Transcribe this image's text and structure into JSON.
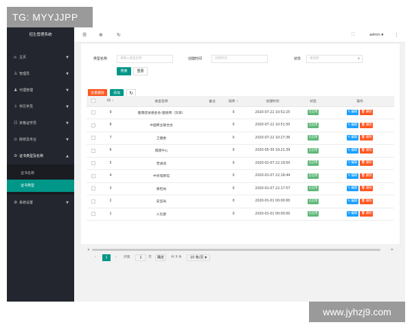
{
  "watermark_top": "TG: MYYJJPP",
  "watermark_bottom": "www.jyhzj9.com",
  "sidebar": {
    "title": "招生管理系统",
    "items": [
      {
        "label": "主页",
        "icon": "home-icon",
        "glyph": "⌂"
      },
      {
        "label": "管理员",
        "icon": "user-icon",
        "glyph": "♙"
      },
      {
        "label": "代理管理",
        "icon": "person-icon",
        "glyph": "♟"
      },
      {
        "label": "学历学员",
        "icon": "student-icon",
        "glyph": "♗"
      },
      {
        "label": "资格证学员",
        "icon": "group-icon",
        "glyph": "☷"
      },
      {
        "label": "院校及专业",
        "icon": "school-icon",
        "glyph": "⊙"
      },
      {
        "label": "证书类型及名称",
        "icon": "gear-icon",
        "glyph": "⚙"
      }
    ],
    "sub_items": [
      {
        "label": "证书名称"
      },
      {
        "label": "证书类型"
      }
    ],
    "last_item": {
      "label": "系统设置",
      "icon": "settings-icon",
      "glyph": "⚙"
    }
  },
  "topbar": {
    "menu_glyph": "☰",
    "globe_glyph": "⊕",
    "refresh_glyph": "↻",
    "fullscreen_glyph": "⛶",
    "user": "admin",
    "more_glyph": "⋮"
  },
  "filters": {
    "type_name_label": "类型名称",
    "type_name_placeholder": "请输入类型名称",
    "created_label": "创建时间",
    "created_placeholder": "创建时间",
    "status_label": "状态",
    "status_placeholder": "请选择",
    "search_label": "搜索",
    "reset_label": "重置"
  },
  "toolbar": {
    "batch_delete": "批量删除",
    "add": "添加",
    "refresh_glyph": "↻"
  },
  "table": {
    "headers": [
      "ID",
      "类型名称",
      "备注",
      "排序",
      "创建时间",
      "状态",
      "操作"
    ],
    "rows": [
      {
        "id": "9",
        "name": "健康促进基金会-国培网（双章）",
        "remark": "",
        "sort": "0",
        "created": "2020-07-22 10:52:25",
        "status": "已启用"
      },
      {
        "id": "8",
        "name": "中国商业联合会",
        "remark": "",
        "sort": "0",
        "created": "2020-07-22 10:51:50",
        "status": "已启用"
      },
      {
        "id": "7",
        "name": "卫健委",
        "remark": "",
        "sort": "0",
        "created": "2020-07-22 10:27:36",
        "status": "已启用"
      },
      {
        "id": "6",
        "name": "城建中心",
        "remark": "",
        "sort": "0",
        "created": "2020-05-30 19:21:39",
        "status": "已启用"
      },
      {
        "id": "5",
        "name": "普通话",
        "remark": "",
        "sort": "0",
        "created": "2020-01-07 22:19:50",
        "status": "已启用"
      },
      {
        "id": "4",
        "name": "中央电教馆",
        "remark": "",
        "sort": "0",
        "created": "2020-01-07 22:18:44",
        "status": "已启用"
      },
      {
        "id": "3",
        "name": "质检局",
        "remark": "",
        "sort": "0",
        "created": "2020-01-07 22:17:57",
        "status": "已启用"
      },
      {
        "id": "2",
        "name": "安监局",
        "remark": "",
        "sort": "0",
        "created": "2020-01-01 00:00:00",
        "status": "已启用"
      },
      {
        "id": "1",
        "name": "人社部",
        "remark": "",
        "sort": "0",
        "created": "2020-01-01 00:00:00",
        "status": "已启用"
      }
    ],
    "edit_label": "✎ 编辑",
    "delete_label": "🗑 删除"
  },
  "pager": {
    "prev": "‹",
    "current": "1",
    "next": "›",
    "goto_label": "到第",
    "goto_value": "1",
    "page_unit": "页",
    "confirm": "确定",
    "total": "共 9 条",
    "per_page": "10 条/页"
  }
}
